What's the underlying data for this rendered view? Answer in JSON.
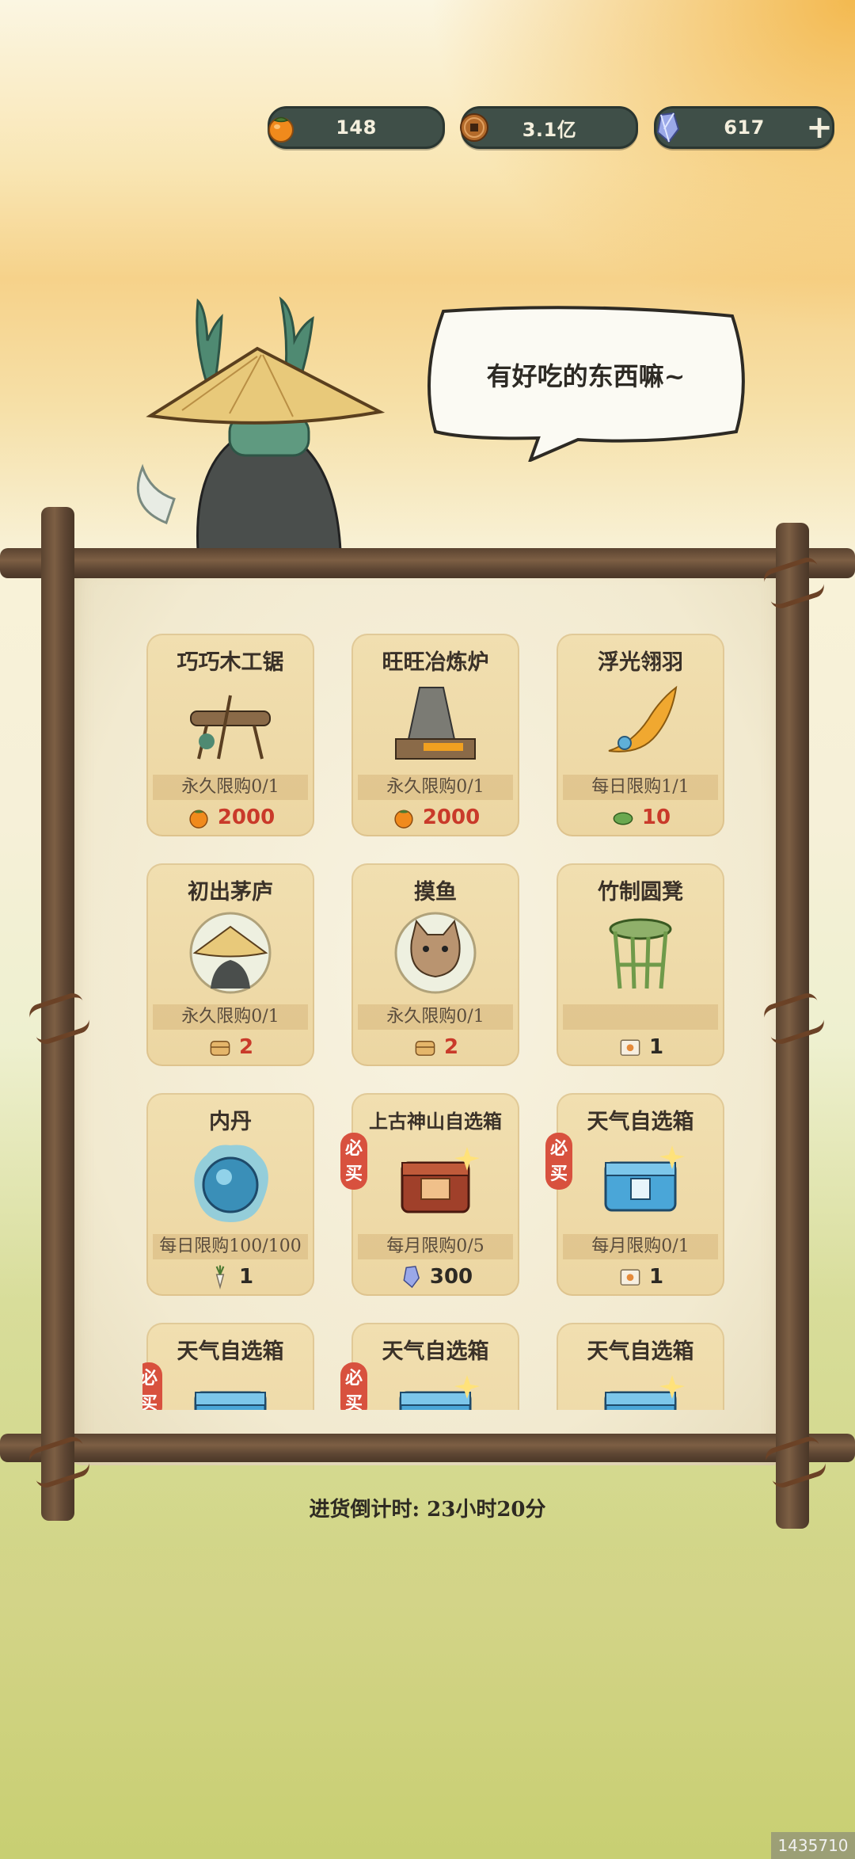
{
  "currencies": [
    {
      "name": "persimmon",
      "icon": "persimmon-icon",
      "value": "148"
    },
    {
      "name": "copper-coin",
      "icon": "coin-icon",
      "value": "3.1亿"
    },
    {
      "name": "gem",
      "icon": "gem-icon",
      "value": "617"
    }
  ],
  "add_label": "+",
  "speech": "有好吃的东西嘛~",
  "shop_items": [
    {
      "name": "巧巧木工锯",
      "art": "saw-workshop-icon",
      "limit": "永久限购0/1",
      "price_icon": "persimmon-icon",
      "price": "2000",
      "price_red": true,
      "must_buy": false
    },
    {
      "name": "旺旺冶炼炉",
      "art": "smelting-furnace-icon",
      "limit": "永久限购0/1",
      "price_icon": "persimmon-icon",
      "price": "2000",
      "price_red": true,
      "must_buy": false
    },
    {
      "name": "浮光翎羽",
      "art": "feather-icon",
      "limit": "每日限购1/1",
      "price_icon": "jade-leaf-icon",
      "price": "10",
      "price_red": true,
      "must_buy": false
    },
    {
      "name": "初出茅庐",
      "art": "straw-hat-avatar-icon",
      "limit": "永久限购0/1",
      "price_icon": "steamer-icon",
      "price": "2",
      "price_red": true,
      "must_buy": false
    },
    {
      "name": "摸鱼",
      "art": "cat-avatar-icon",
      "limit": "永久限购0/1",
      "price_icon": "steamer-icon",
      "price": "2",
      "price_red": true,
      "must_buy": false
    },
    {
      "name": "竹制圆凳",
      "art": "bamboo-stool-icon",
      "limit": "",
      "price_icon": "ticket-icon",
      "price": "1",
      "price_red": false,
      "must_buy": false
    },
    {
      "name": "内丹",
      "art": "spirit-orb-icon",
      "limit": "每日限购100/100",
      "price_icon": "radish-icon",
      "price": "1",
      "price_red": false,
      "must_buy": false
    },
    {
      "name": "上古神山自选箱",
      "art": "treasure-chest-icon",
      "limit": "每月限购0/5",
      "price_icon": "gem-icon",
      "price": "300",
      "price_red": false,
      "must_buy": true
    },
    {
      "name": "天气自选箱",
      "art": "weather-chest-icon",
      "limit": "每月限购0/1",
      "price_icon": "ticket-icon",
      "price": "1",
      "price_red": false,
      "must_buy": true
    },
    {
      "name": "天气自选箱",
      "art": "weather-chest-icon",
      "limit": "",
      "price_icon": "",
      "price": "",
      "price_red": false,
      "must_buy": true
    },
    {
      "name": "天气自选箱",
      "art": "weather-chest-icon",
      "limit": "",
      "price_icon": "",
      "price": "",
      "price_red": false,
      "must_buy": true
    },
    {
      "name": "天气自选箱",
      "art": "weather-chest-icon",
      "limit": "",
      "price_icon": "",
      "price": "",
      "price_red": false,
      "must_buy": false
    }
  ],
  "must_buy_label": "必买",
  "restock_countdown": "进货倒计时: 23小时20分",
  "watermark": "1435710",
  "colors": {
    "price_red": "#c93a2a",
    "pill_bg": "#3f4f48",
    "must_buy_bg": "#d8513e"
  }
}
